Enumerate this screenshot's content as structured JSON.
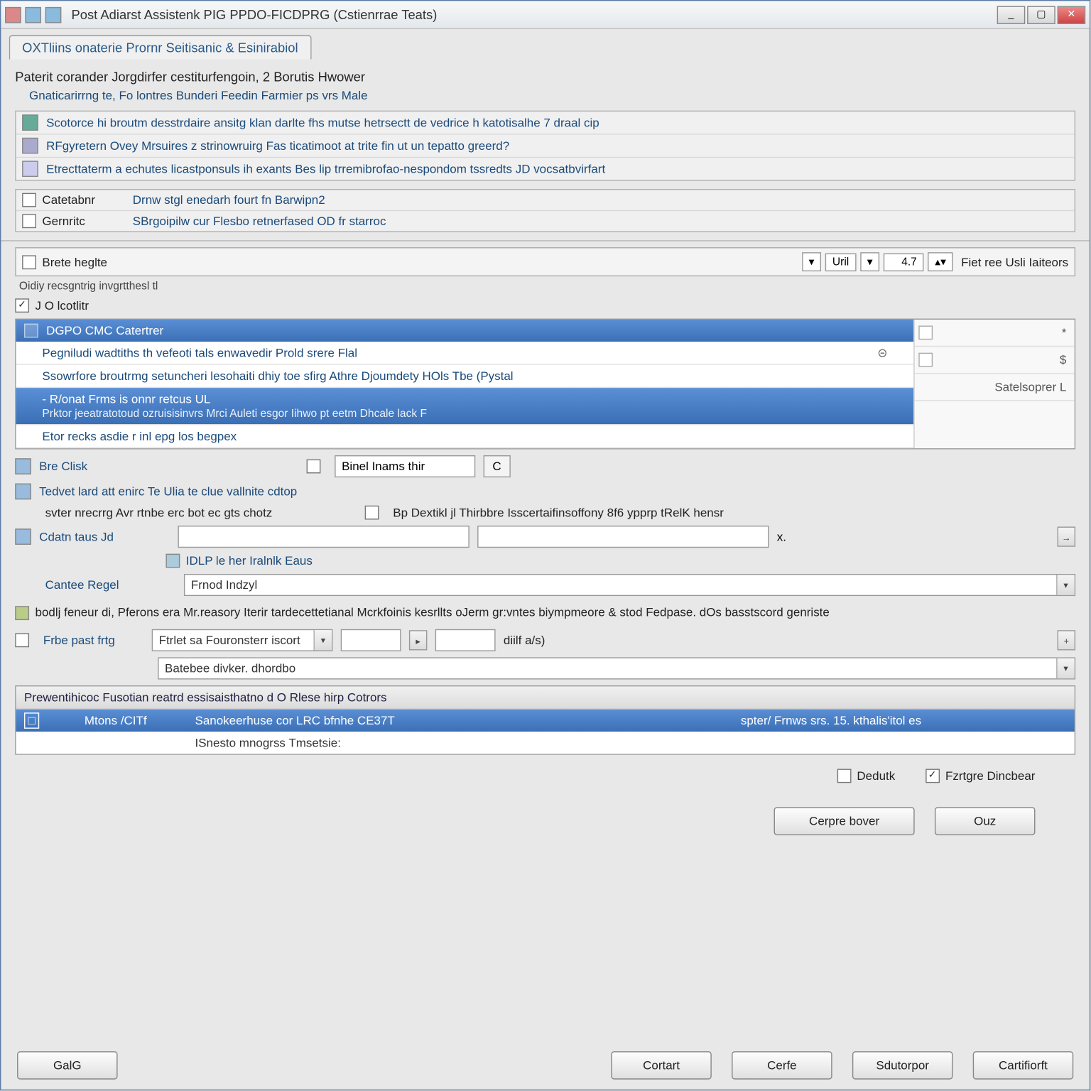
{
  "title": "Post Adiarst Assistenk PIG  PPDO-FICDPRG (Cstienrrae Teats)",
  "tab": "OXTliins onaterie Prornr Seitisanic & Esinirabiol",
  "section_title": "Paterit corander  Jorgdirfer cestiturfengoin, 2 Borutis Hwower",
  "subtitle": "Gnaticarirrng te, Fo lontres Bunderi Feedin Farmier ps vrs Male",
  "info_lines": [
    "Scotorce hi broutm desstrdaire ansitg klan darlte fhs mutse hetrsectt de vedrice h katotisalhe 7 draal cip",
    "RFgyretern Ovey Mrsuires z strinowruirg Fas ticatimoot at trite fin ut un tepatto greerd?",
    "Etrecttaterm a echutes licastponsuls ih exants Bes lip trremibrofao-nespondom tssredts JD vocsatbvirfart"
  ],
  "cat_rows": [
    {
      "label": "Catetabnr",
      "desc": "Drnw stgl enedarh fourt fn Barwipn2"
    },
    {
      "label": "Gernritc",
      "desc": "SBrgoipilw cur Flesbo retnerfased OD fr starroc"
    }
  ],
  "brace_label": "Brete heglte",
  "brace_unit": "Uril",
  "brace_val": "4.7",
  "brace_after": "Fiet ree Usli Iaiteors",
  "brace_hint": "Oidiy recsgntrig invgrtthesl tl",
  "outline_check": "J O lcotlitr",
  "list": {
    "header": "DGPO CMC Catertrer",
    "rows": [
      {
        "text": "Pegniludi wadtiths th vefeoti tals enwavedir Prold srere Flal",
        "sel": false
      },
      "Ssowrfore broutrmg setuncheri lesohaiti dhiy toe sfirg Athre Djoumdety HOls Tbe (Pystal",
      {
        "text": "- R/onat Frms is onnr retcus UL",
        "sub": "Prktor jeeatratotoud ozruisisinvrs Mrci Auleti esgor Iihwo pt eetm Dhcale lack F",
        "sel": true
      },
      "Etor recks asdie r inl epg los begpex"
    ],
    "side": [
      "*",
      "$",
      "Satelsoprer L"
    ]
  },
  "bre_clisk": "Bre Clisk",
  "bre_field": "Binel Inams thir",
  "bre_c": "C",
  "cb1": "Tedvet lard att enirc Te Ulia te clue vallnite cdtop",
  "cb2_left": "svter nrecrrg Avr rtnbe erc bot ec gts chotz",
  "cb2_right_chk": "Bp Dextikl jl Thirbbre Isscertaifinsoffony 8f6 ypprp tRelK hensr",
  "clstr": "Cdatn taus Jd",
  "clstr_sfx": "x.",
  "clstr_hint": "IDLP le her Iralnlk Eaus",
  "cantee": "Cantee Regel",
  "cantee_val": "Frnod Indzyl",
  "note": "bodlj feneur di, Pferons era Mr.reasory Iterir tardecettetianal Mcrkfoinis kesrllts oJerm gr:vntes biympmeore & stod Fedpase. dOs basstscord genriste",
  "fps_label": "Frbe past frtg",
  "fps_val1": "Ftrlet sa Fouronsterr iscort",
  "fps_unit": "diilf a/s)",
  "fps_val2": "Batebee divker. dhordbo",
  "tbl_hdr": "Prewentihicoc  Fusotian reatrd essisaisthatno d O Rlese hirp Cotrors",
  "tbl_rows": [
    {
      "sel": true,
      "c1": "□",
      "c2": "Mtons /CITf",
      "c3": "Sanokeerhuse cor LRC bfnhe CE37T",
      "c4": "spter/ Frnws srs. 15. kthalis'itol es"
    },
    {
      "sel": false,
      "c1": "",
      "c2": "",
      "c3": "ISnesto mnogrss Tmsetsie:",
      "c4": ""
    }
  ],
  "chk_dedutk": "Dedutk",
  "chk_fzm": "Fzrtgre Dincbear",
  "btn_cprse": "Cerpre bover",
  "btn_ouz": "Ouz",
  "footer": {
    "galg": "GalG",
    "cortart": "Cortart",
    "cerfe": "Cerfe",
    "sdutorpor": "Sdutorpor",
    "cartifiorft": "Cartifiorft"
  }
}
